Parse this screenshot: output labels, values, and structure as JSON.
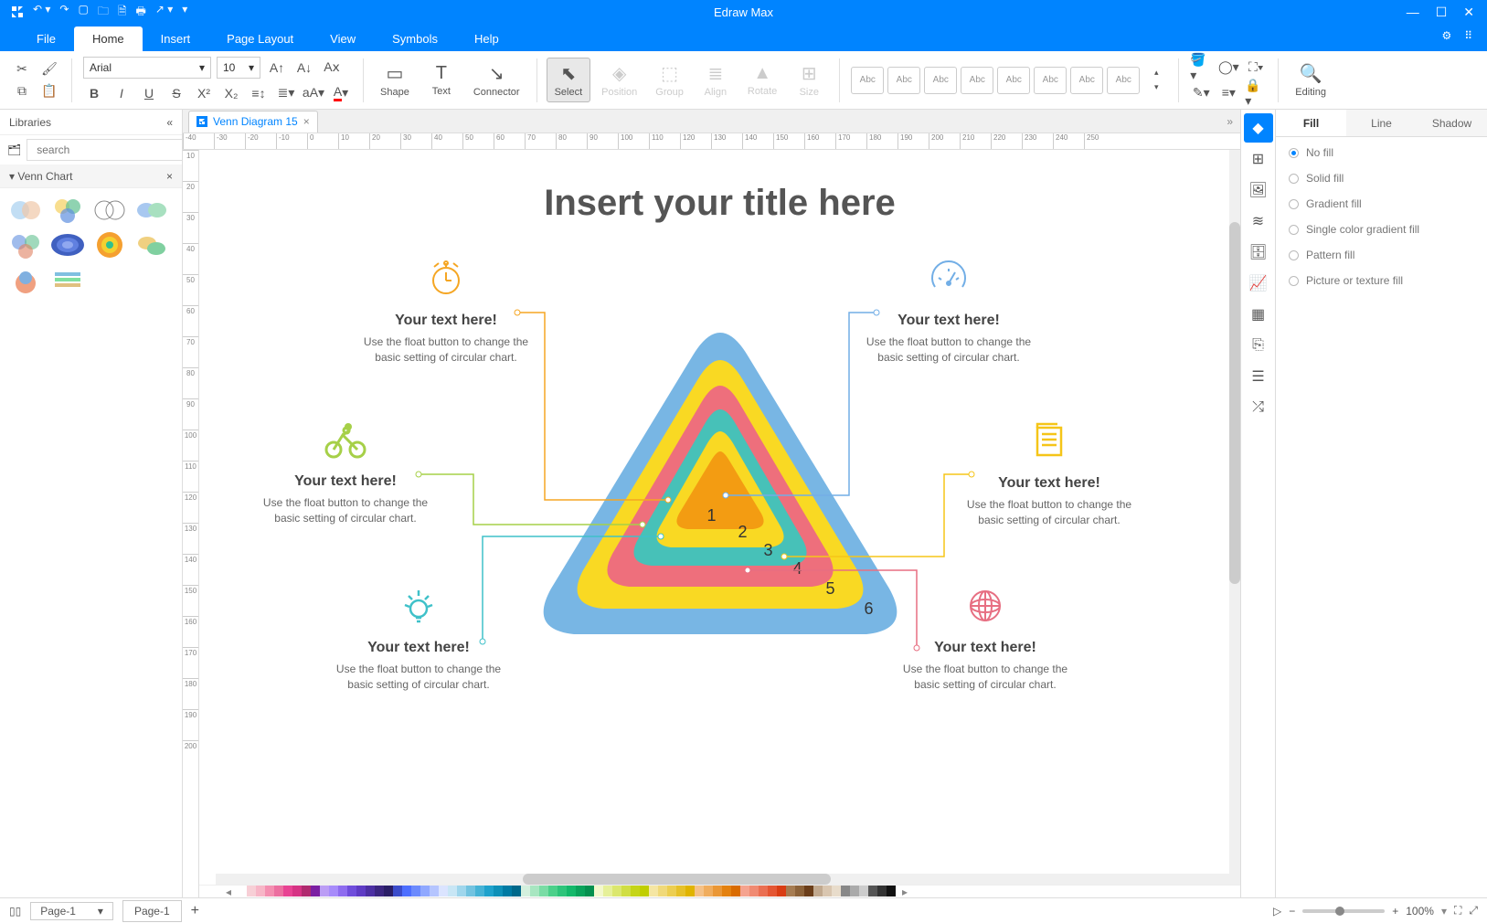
{
  "app": {
    "title": "Edraw Max"
  },
  "menubar": {
    "tabs": [
      "File",
      "Home",
      "Insert",
      "Page Layout",
      "View",
      "Symbols",
      "Help"
    ],
    "active": "Home"
  },
  "ribbon": {
    "font": "Arial",
    "size": "10",
    "groups": {
      "shape": "Shape",
      "text": "Text",
      "connector": "Connector",
      "select": "Select",
      "position": "Position",
      "group": "Group",
      "align": "Align",
      "rotate": "Rotate",
      "size": "Size",
      "editing": "Editing"
    },
    "theme_label": "Abc"
  },
  "left": {
    "title": "Libraries",
    "search_placeholder": "search",
    "category": "Venn Chart"
  },
  "doc": {
    "tab": "Venn Diagram 15"
  },
  "rightpanel": {
    "tabs": [
      "Fill",
      "Line",
      "Shadow"
    ],
    "active": "Fill",
    "options": [
      "No fill",
      "Solid fill",
      "Gradient fill",
      "Single color gradient fill",
      "Pattern fill",
      "Picture or texture fill"
    ]
  },
  "canvas": {
    "title": "Insert your title here",
    "callouts": [
      {
        "title": "Your text here!",
        "text": "Use the float button to change the basic setting of circular chart.",
        "color": "#f5a623"
      },
      {
        "title": "Your text here!",
        "text": "Use the float button to change the basic setting of circular chart.",
        "color": "#72aee6"
      },
      {
        "title": "Your text here!",
        "text": "Use the float button to change the basic setting of circular chart.",
        "color": "#a6d048"
      },
      {
        "title": "Your text here!",
        "text": "Use the float button to change the basic setting of circular chart.",
        "color": "#f5c518"
      },
      {
        "title": "Your text here!",
        "text": "Use the float button to change the basic setting of circular chart.",
        "color": "#3fc1c9"
      },
      {
        "title": "Your text here!",
        "text": "Use the float button to change the basic setting of circular chart.",
        "color": "#e76f82"
      }
    ],
    "numbers": [
      "1",
      "2",
      "3",
      "4",
      "5",
      "6"
    ]
  },
  "status": {
    "page_sel": "Page-1",
    "page_tab": "Page-1",
    "zoom": "100%"
  },
  "ruler_h": [
    -40,
    -30,
    -20,
    -10,
    0,
    10,
    20,
    30,
    40,
    50,
    60,
    70,
    80,
    90,
    100,
    110,
    120,
    130,
    140,
    150,
    160,
    170,
    180,
    190,
    200,
    210,
    220,
    230,
    240,
    250
  ],
  "ruler_v": [
    10,
    20,
    30,
    40,
    50,
    60,
    70,
    80,
    90,
    100,
    110,
    120,
    130,
    140,
    150,
    160,
    170,
    180,
    190,
    200
  ],
  "colors": [
    "#ffffff",
    "#f7cfd6",
    "#f7b6c7",
    "#f48fb1",
    "#ec6fa0",
    "#e84393",
    "#d63384",
    "#b02a6f",
    "#7b1fa2",
    "#bb9df5",
    "#a78bfa",
    "#8e6cef",
    "#6f4ddb",
    "#5e3bc4",
    "#4c2fa3",
    "#3b2680",
    "#2a1e66",
    "#3b4cca",
    "#4d6fff",
    "#6b8afd",
    "#8fa8ff",
    "#b5c5ff",
    "#dbe4ff",
    "#c8e6f5",
    "#9fd6ec",
    "#72c3e0",
    "#46b3d6",
    "#1fa2cc",
    "#0e90b8",
    "#007aa3",
    "#00688a",
    "#d4f0de",
    "#a8e6c1",
    "#7adca5",
    "#4cd08a",
    "#2ec47a",
    "#14b86a",
    "#0aa35b",
    "#05904f",
    "#f3f8cc",
    "#e6f099",
    "#dbe76e",
    "#d0de43",
    "#c5d518",
    "#c0ce00",
    "#f5e6a3",
    "#f0d97a",
    "#ecce52",
    "#e6c12a",
    "#e0b400",
    "#f5c187",
    "#f0ad5e",
    "#ea9736",
    "#e4810f",
    "#d96b00",
    "#f5a38f",
    "#f08a72",
    "#ea6f52",
    "#e45633",
    "#d93d14",
    "#a67c52",
    "#8c6239",
    "#6b3e1a",
    "#c1a98f",
    "#d9c6b0",
    "#e8dccb",
    "#888888",
    "#aaaaaa",
    "#cccccc",
    "#555555",
    "#333333",
    "#111111"
  ]
}
